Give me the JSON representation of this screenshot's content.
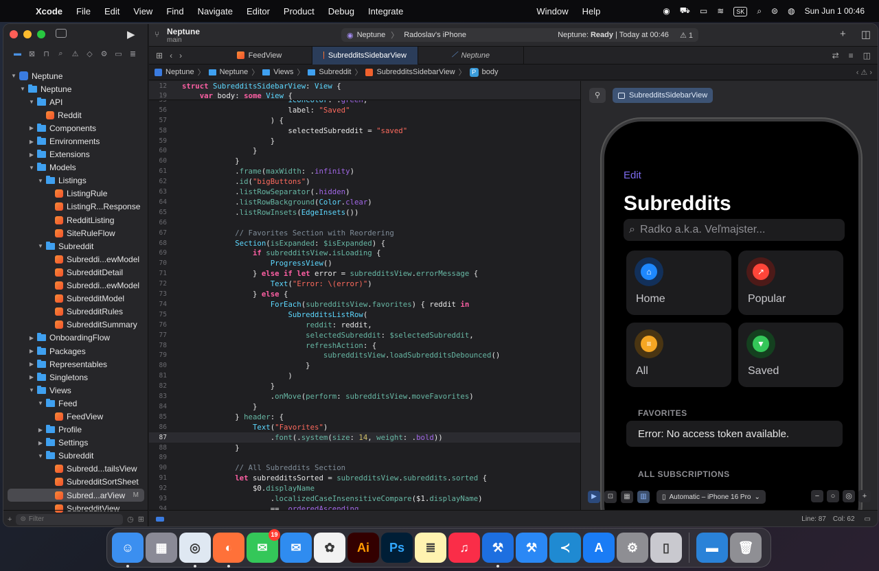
{
  "menubar": {
    "app": "Xcode",
    "items": [
      "File",
      "Edit",
      "View",
      "Find",
      "Navigate",
      "Editor",
      "Product",
      "Debug",
      "Integrate",
      "Window",
      "Help"
    ],
    "input_source": "SK",
    "datetime": "Sun Jun 1  00:46"
  },
  "toolbar": {
    "project_name": "Neptune",
    "branch": "main",
    "scheme": "Neptune",
    "destination": "Radoslav's iPhone",
    "status_app": "Neptune:",
    "status_state": "Ready",
    "status_time": "| Today at 00:46",
    "warning_count": "1"
  },
  "navigator": {
    "items": [
      {
        "label": "Neptune",
        "type": "project",
        "depth": 0,
        "open": true
      },
      {
        "label": "Neptune",
        "type": "folder",
        "depth": 1,
        "open": true
      },
      {
        "label": "API",
        "type": "folder",
        "depth": 2,
        "open": true
      },
      {
        "label": "Reddit",
        "type": "swift",
        "depth": 3
      },
      {
        "label": "Components",
        "type": "folder",
        "depth": 2,
        "open": false
      },
      {
        "label": "Environments",
        "type": "folder",
        "depth": 2,
        "open": false
      },
      {
        "label": "Extensions",
        "type": "folder",
        "depth": 2,
        "open": false
      },
      {
        "label": "Models",
        "type": "folder",
        "depth": 2,
        "open": true
      },
      {
        "label": "Listings",
        "type": "folder",
        "depth": 3,
        "open": true
      },
      {
        "label": "ListingRule",
        "type": "swift",
        "depth": 4
      },
      {
        "label": "ListingR...Response",
        "type": "swift",
        "depth": 4
      },
      {
        "label": "RedditListing",
        "type": "swift",
        "depth": 4
      },
      {
        "label": "SiteRuleFlow",
        "type": "swift",
        "depth": 4
      },
      {
        "label": "Subreddit",
        "type": "folder",
        "depth": 3,
        "open": true
      },
      {
        "label": "Subreddi...ewModel",
        "type": "swift",
        "depth": 4
      },
      {
        "label": "SubredditDetail",
        "type": "swift",
        "depth": 4
      },
      {
        "label": "Subreddi...ewModel",
        "type": "swift",
        "depth": 4
      },
      {
        "label": "SubredditModel",
        "type": "swift",
        "depth": 4
      },
      {
        "label": "SubredditRules",
        "type": "swift",
        "depth": 4
      },
      {
        "label": "SubredditSummary",
        "type": "swift",
        "depth": 4
      },
      {
        "label": "OnboardingFlow",
        "type": "folder",
        "depth": 2,
        "open": false
      },
      {
        "label": "Packages",
        "type": "folder",
        "depth": 2,
        "open": false
      },
      {
        "label": "Representables",
        "type": "folder",
        "depth": 2,
        "open": false
      },
      {
        "label": "Singletons",
        "type": "folder",
        "depth": 2,
        "open": false
      },
      {
        "label": "Views",
        "type": "folder",
        "depth": 2,
        "open": true
      },
      {
        "label": "Feed",
        "type": "folder",
        "depth": 3,
        "open": true
      },
      {
        "label": "FeedView",
        "type": "swift",
        "depth": 4
      },
      {
        "label": "Profile",
        "type": "folder",
        "depth": 3,
        "open": false
      },
      {
        "label": "Settings",
        "type": "folder",
        "depth": 3,
        "open": false
      },
      {
        "label": "Subreddit",
        "type": "folder",
        "depth": 3,
        "open": true
      },
      {
        "label": "Subredd...tailsView",
        "type": "swift",
        "depth": 4
      },
      {
        "label": "SubredditSortSheet",
        "type": "swift",
        "depth": 4
      },
      {
        "label": "Subred...arView",
        "type": "swift",
        "depth": 4,
        "selected": true,
        "badge": "M"
      },
      {
        "label": "SubredditView",
        "type": "swift",
        "depth": 4
      }
    ],
    "filter_placeholder": "Filter"
  },
  "tabs": [
    {
      "label": "FeedView",
      "active": false
    },
    {
      "label": "SubredditsSidebarView",
      "active": true
    },
    {
      "label": "Neptune",
      "active": false,
      "preview": true
    }
  ],
  "breadcrumb": [
    "Neptune",
    "Neptune",
    "Views",
    "Subreddit",
    "SubredditsSidebarView",
    "body"
  ],
  "editor": {
    "sticky": [
      {
        "n": "12",
        "html": "<span class=\"kw\">struct</span> <span class=\"ty\">SubredditsSidebarView</span>: <span class=\"ty\">View</span> {"
      },
      {
        "n": "19",
        "html": "    <span class=\"kw\">var</span> body: <span class=\"kw\">some</span> <span class=\"ty\">View</span> {"
      }
    ],
    "lines": [
      {
        "n": "55",
        "html": "                        <span class=\"ty\">iconColor</span>: .<span class=\"pr\">green</span>,"
      },
      {
        "n": "56",
        "html": "                        label: <span class=\"st\">\"Saved\"</span>"
      },
      {
        "n": "57",
        "html": "                    ) {"
      },
      {
        "n": "58",
        "html": "                        selectedSubreddit = <span class=\"st\">\"saved\"</span>"
      },
      {
        "n": "59",
        "html": "                    }"
      },
      {
        "n": "60",
        "html": "                }"
      },
      {
        "n": "60",
        "html": "            }"
      },
      {
        "n": "61",
        "html": "            .<span class=\"fn\">frame</span>(<span class=\"fn\">maxWidth</span>: .<span class=\"pr\">infinity</span>)"
      },
      {
        "n": "62",
        "html": "            .<span class=\"fn\">id</span>(<span class=\"st\">\"bigButtons\"</span>)"
      },
      {
        "n": "63",
        "html": "            .<span class=\"fn\">listRowSeparator</span>(.<span class=\"pr\">hidden</span>)"
      },
      {
        "n": "64",
        "html": "            .<span class=\"fn\">listRowBackground</span>(<span class=\"ty\">Color</span>.<span class=\"pr\">clear</span>)"
      },
      {
        "n": "65",
        "html": "            .<span class=\"fn\">listRowInsets</span>(<span class=\"ty\">EdgeInsets</span>())"
      },
      {
        "n": "66",
        "html": ""
      },
      {
        "n": "67",
        "html": "            <span class=\"cm\">// Favorites Section with Reordering</span>"
      },
      {
        "n": "68",
        "html": "            <span class=\"ty\">Section</span>(<span class=\"fn\">isExpanded</span>: <span class=\"fn\">$isExpanded</span>) {"
      },
      {
        "n": "69",
        "html": "                <span class=\"kw\">if</span> <span class=\"fn\">subredditsView</span>.<span class=\"fn\">isLoading</span> {"
      },
      {
        "n": "70",
        "html": "                    <span class=\"ty\">ProgressView</span>()"
      },
      {
        "n": "71",
        "html": "                } <span class=\"kw\">else if let</span> error = <span class=\"fn\">subredditsView</span>.<span class=\"fn\">errorMessage</span> {"
      },
      {
        "n": "72",
        "html": "                    <span class=\"ty\">Text</span>(<span class=\"st\">\"Error: \\(error)\"</span>)"
      },
      {
        "n": "73",
        "html": "                } <span class=\"kw\">else</span> {"
      },
      {
        "n": "74",
        "html": "                    <span class=\"ty\">ForEach</span>(<span class=\"fn\">subredditsView</span>.<span class=\"fn\">favorites</span>) { reddit <span class=\"kw\">in</span>"
      },
      {
        "n": "75",
        "html": "                        <span class=\"ty\">SubredditsListRow</span>("
      },
      {
        "n": "76",
        "html": "                            <span class=\"fn\">reddit</span>: reddit,"
      },
      {
        "n": "77",
        "html": "                            <span class=\"fn\">selectedSubreddit</span>: <span class=\"fn\">$selectedSubreddit</span>,"
      },
      {
        "n": "78",
        "html": "                            <span class=\"fn\">refreshAction</span>: {"
      },
      {
        "n": "79",
        "html": "                                <span class=\"fn\">subredditsView</span>.<span class=\"fn\">loadSubredditsDebounced</span>()"
      },
      {
        "n": "80",
        "html": "                            }"
      },
      {
        "n": "81",
        "html": "                        )"
      },
      {
        "n": "82",
        "html": "                    }"
      },
      {
        "n": "83",
        "html": "                    .<span class=\"fn\">onMove</span>(<span class=\"fn\">perform</span>: <span class=\"fn\">subredditsView</span>.<span class=\"fn\">moveFavorites</span>)"
      },
      {
        "n": "84",
        "html": "                }"
      },
      {
        "n": "85",
        "html": "            } <span class=\"fn\">header</span>: {"
      },
      {
        "n": "86",
        "html": "                <span class=\"ty\">Text</span>(<span class=\"st\">\"Favorites\"</span>)"
      },
      {
        "n": "87",
        "html": "                    .<span class=\"fn\">font</span>(.<span class=\"fn\">system</span>(<span class=\"fn\">size</span>: <span class=\"nu\">14</span>, <span class=\"fn\">weight</span>: .<span class=\"pr\">bold</span>))",
        "current": true
      },
      {
        "n": "88",
        "html": "            }"
      },
      {
        "n": "89",
        "html": ""
      },
      {
        "n": "90",
        "html": "            <span class=\"cm\">// All Subreddits Section</span>"
      },
      {
        "n": "91",
        "html": "            <span class=\"kw\">let</span> subredditsSorted = <span class=\"fn\">subredditsView</span>.<span class=\"fn\">subreddits</span>.<span class=\"fn\">sorted</span> {"
      },
      {
        "n": "92",
        "html": "                $0.<span class=\"fn\">displayName</span>"
      },
      {
        "n": "93",
        "html": "                    .<span class=\"fn\">localizedCaseInsensitiveCompare</span>($1.<span class=\"fn\">displayName</span>)"
      },
      {
        "n": "94",
        "html": "                    == .<span class=\"pr\">orderedAscending</span>"
      }
    ]
  },
  "preview": {
    "tag": "SubredditsSidebarView",
    "edit": "Edit",
    "title": "Subreddits",
    "search_placeholder": "Radko a.k.a. Veľmajster...",
    "cards": [
      {
        "label": "Home",
        "color": "#1e88ff",
        "bg": "#12305a",
        "glyph": "⌂"
      },
      {
        "label": "Popular",
        "color": "#ff4539",
        "bg": "#4d1a18",
        "glyph": "↗"
      },
      {
        "label": "All",
        "color": "#f5a623",
        "bg": "#4a3512",
        "glyph": "≡"
      },
      {
        "label": "Saved",
        "color": "#34c759",
        "bg": "#14401f",
        "glyph": "▼"
      }
    ],
    "favorites_header": "FAVORITES",
    "error_text": "Error: No access token available.",
    "all_header": "ALL SUBSCRIPTIONS",
    "device": "Automatic – iPhone 16 Pro"
  },
  "status": {
    "line": "Line: 87",
    "col": "Col: 62"
  },
  "dock": [
    {
      "name": "finder",
      "bg": "#3b8ff0",
      "glyph": "☺",
      "running": true
    },
    {
      "name": "launchpad",
      "bg": "#8a8a96",
      "glyph": "▦"
    },
    {
      "name": "safari",
      "bg": "#dfe8f2",
      "glyph": "◎",
      "running": true
    },
    {
      "name": "firefox",
      "bg": "#ff7139",
      "glyph": "◐",
      "running": true
    },
    {
      "name": "messages",
      "bg": "#34c759",
      "glyph": "✉",
      "badge": "19"
    },
    {
      "name": "mail",
      "bg": "#2f8cf0",
      "glyph": "✉"
    },
    {
      "name": "photos",
      "bg": "#f2f2f2",
      "glyph": "✿"
    },
    {
      "name": "illustrator",
      "bg": "#330000",
      "glyph": "Ai"
    },
    {
      "name": "photoshop",
      "bg": "#001e36",
      "glyph": "Ps"
    },
    {
      "name": "notes",
      "bg": "#fff3b0",
      "glyph": "≣"
    },
    {
      "name": "music",
      "bg": "#fa2d48",
      "glyph": "♫"
    },
    {
      "name": "xcode-beta",
      "bg": "#1d6fe0",
      "glyph": "⚒",
      "running": true
    },
    {
      "name": "xcode",
      "bg": "#2a88f5",
      "glyph": "⚒"
    },
    {
      "name": "vscode",
      "bg": "#1f8ad2",
      "glyph": "≺"
    },
    {
      "name": "app-store",
      "bg": "#1a7cf5",
      "glyph": "A"
    },
    {
      "name": "system-settings",
      "bg": "#8e8e93",
      "glyph": "⚙"
    },
    {
      "name": "iphone-mirroring",
      "bg": "#c9c9cf",
      "glyph": "▯"
    },
    {
      "name": "folder",
      "bg": "#2a82d8",
      "glyph": "▬"
    },
    {
      "name": "trash",
      "bg": "#8f8f94",
      "glyph": "🗑"
    }
  ]
}
